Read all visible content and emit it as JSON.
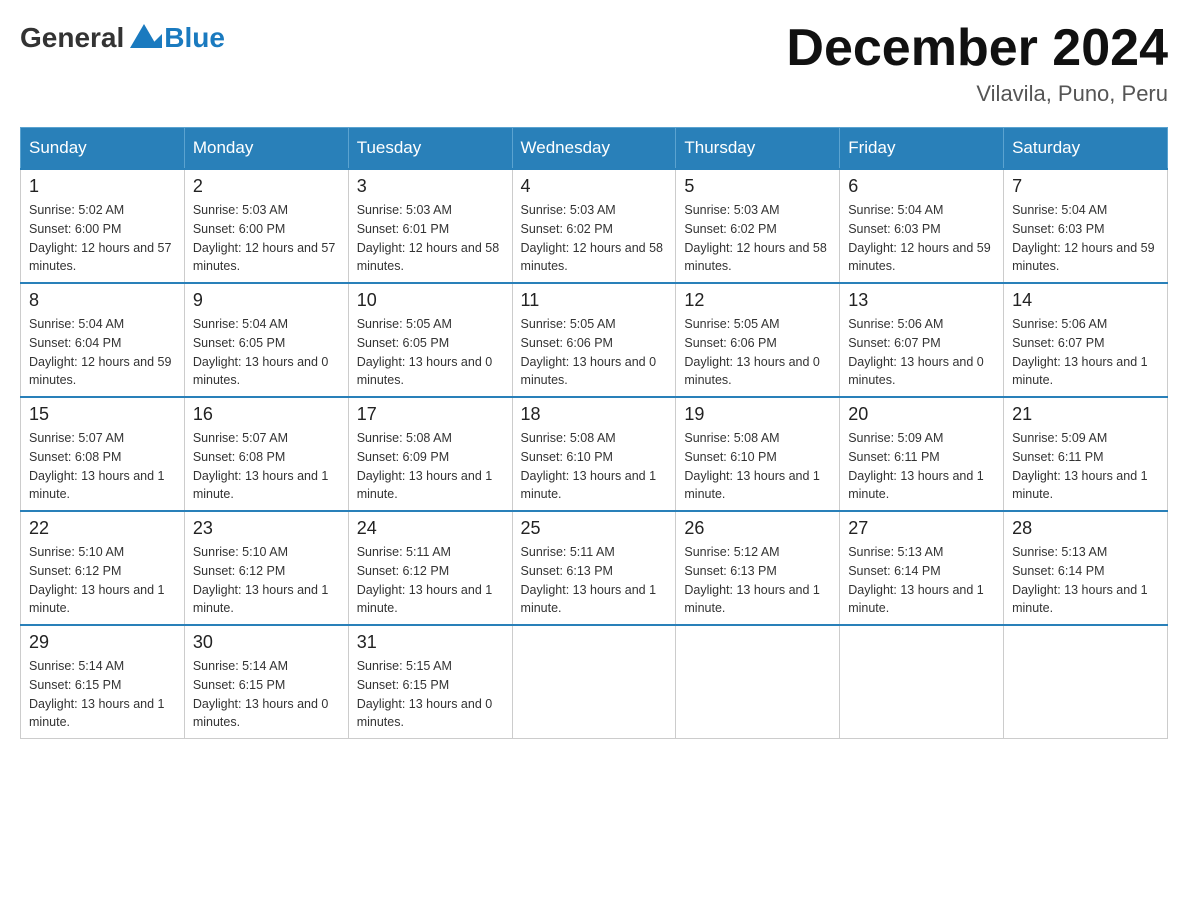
{
  "header": {
    "logo_general": "General",
    "logo_blue": "Blue",
    "month_year": "December 2024",
    "location": "Vilavila, Puno, Peru"
  },
  "days_of_week": [
    "Sunday",
    "Monday",
    "Tuesday",
    "Wednesday",
    "Thursday",
    "Friday",
    "Saturday"
  ],
  "weeks": [
    [
      {
        "day": "1",
        "sunrise": "5:02 AM",
        "sunset": "6:00 PM",
        "daylight": "12 hours and 57 minutes."
      },
      {
        "day": "2",
        "sunrise": "5:03 AM",
        "sunset": "6:00 PM",
        "daylight": "12 hours and 57 minutes."
      },
      {
        "day": "3",
        "sunrise": "5:03 AM",
        "sunset": "6:01 PM",
        "daylight": "12 hours and 58 minutes."
      },
      {
        "day": "4",
        "sunrise": "5:03 AM",
        "sunset": "6:02 PM",
        "daylight": "12 hours and 58 minutes."
      },
      {
        "day": "5",
        "sunrise": "5:03 AM",
        "sunset": "6:02 PM",
        "daylight": "12 hours and 58 minutes."
      },
      {
        "day": "6",
        "sunrise": "5:04 AM",
        "sunset": "6:03 PM",
        "daylight": "12 hours and 59 minutes."
      },
      {
        "day": "7",
        "sunrise": "5:04 AM",
        "sunset": "6:03 PM",
        "daylight": "12 hours and 59 minutes."
      }
    ],
    [
      {
        "day": "8",
        "sunrise": "5:04 AM",
        "sunset": "6:04 PM",
        "daylight": "12 hours and 59 minutes."
      },
      {
        "day": "9",
        "sunrise": "5:04 AM",
        "sunset": "6:05 PM",
        "daylight": "13 hours and 0 minutes."
      },
      {
        "day": "10",
        "sunrise": "5:05 AM",
        "sunset": "6:05 PM",
        "daylight": "13 hours and 0 minutes."
      },
      {
        "day": "11",
        "sunrise": "5:05 AM",
        "sunset": "6:06 PM",
        "daylight": "13 hours and 0 minutes."
      },
      {
        "day": "12",
        "sunrise": "5:05 AM",
        "sunset": "6:06 PM",
        "daylight": "13 hours and 0 minutes."
      },
      {
        "day": "13",
        "sunrise": "5:06 AM",
        "sunset": "6:07 PM",
        "daylight": "13 hours and 0 minutes."
      },
      {
        "day": "14",
        "sunrise": "5:06 AM",
        "sunset": "6:07 PM",
        "daylight": "13 hours and 1 minute."
      }
    ],
    [
      {
        "day": "15",
        "sunrise": "5:07 AM",
        "sunset": "6:08 PM",
        "daylight": "13 hours and 1 minute."
      },
      {
        "day": "16",
        "sunrise": "5:07 AM",
        "sunset": "6:08 PM",
        "daylight": "13 hours and 1 minute."
      },
      {
        "day": "17",
        "sunrise": "5:08 AM",
        "sunset": "6:09 PM",
        "daylight": "13 hours and 1 minute."
      },
      {
        "day": "18",
        "sunrise": "5:08 AM",
        "sunset": "6:10 PM",
        "daylight": "13 hours and 1 minute."
      },
      {
        "day": "19",
        "sunrise": "5:08 AM",
        "sunset": "6:10 PM",
        "daylight": "13 hours and 1 minute."
      },
      {
        "day": "20",
        "sunrise": "5:09 AM",
        "sunset": "6:11 PM",
        "daylight": "13 hours and 1 minute."
      },
      {
        "day": "21",
        "sunrise": "5:09 AM",
        "sunset": "6:11 PM",
        "daylight": "13 hours and 1 minute."
      }
    ],
    [
      {
        "day": "22",
        "sunrise": "5:10 AM",
        "sunset": "6:12 PM",
        "daylight": "13 hours and 1 minute."
      },
      {
        "day": "23",
        "sunrise": "5:10 AM",
        "sunset": "6:12 PM",
        "daylight": "13 hours and 1 minute."
      },
      {
        "day": "24",
        "sunrise": "5:11 AM",
        "sunset": "6:12 PM",
        "daylight": "13 hours and 1 minute."
      },
      {
        "day": "25",
        "sunrise": "5:11 AM",
        "sunset": "6:13 PM",
        "daylight": "13 hours and 1 minute."
      },
      {
        "day": "26",
        "sunrise": "5:12 AM",
        "sunset": "6:13 PM",
        "daylight": "13 hours and 1 minute."
      },
      {
        "day": "27",
        "sunrise": "5:13 AM",
        "sunset": "6:14 PM",
        "daylight": "13 hours and 1 minute."
      },
      {
        "day": "28",
        "sunrise": "5:13 AM",
        "sunset": "6:14 PM",
        "daylight": "13 hours and 1 minute."
      }
    ],
    [
      {
        "day": "29",
        "sunrise": "5:14 AM",
        "sunset": "6:15 PM",
        "daylight": "13 hours and 1 minute."
      },
      {
        "day": "30",
        "sunrise": "5:14 AM",
        "sunset": "6:15 PM",
        "daylight": "13 hours and 0 minutes."
      },
      {
        "day": "31",
        "sunrise": "5:15 AM",
        "sunset": "6:15 PM",
        "daylight": "13 hours and 0 minutes."
      },
      null,
      null,
      null,
      null
    ]
  ],
  "labels": {
    "sunrise": "Sunrise:",
    "sunset": "Sunset:",
    "daylight": "Daylight:"
  }
}
